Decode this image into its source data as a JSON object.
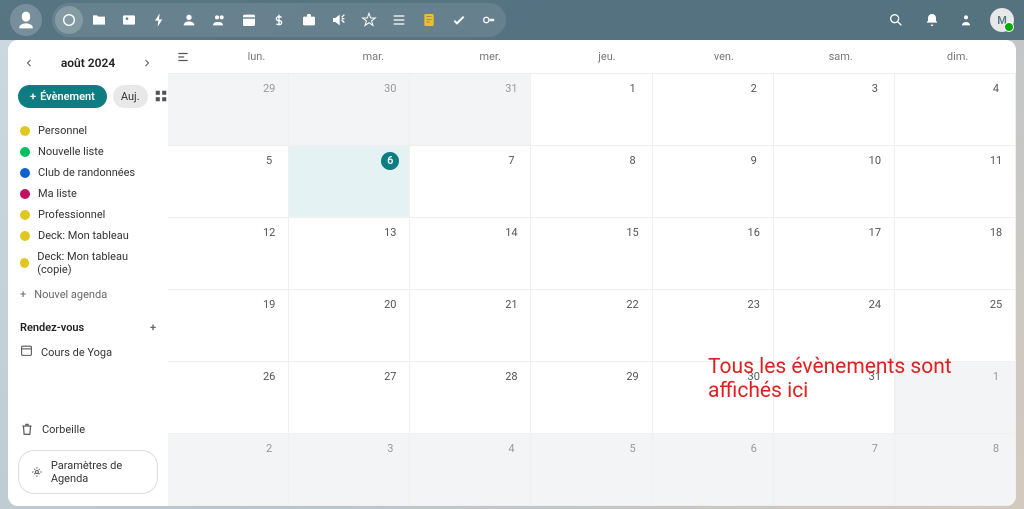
{
  "topbar": {
    "nav_icons": [
      "dashboard",
      "files",
      "photos",
      "activity",
      "contacts",
      "circles",
      "calendar",
      "money",
      "briefcase",
      "announce",
      "star",
      "list",
      "notes",
      "tasks",
      "passwords"
    ]
  },
  "sidebar": {
    "month_title": "août 2024",
    "event_btn": "Évènement",
    "today_btn": "Auj.",
    "calendars": [
      {
        "label": "Personnel",
        "color": "#e0c820"
      },
      {
        "label": "Nouvelle liste",
        "color": "#00c060"
      },
      {
        "label": "Club de randonnées",
        "color": "#1060d0"
      },
      {
        "label": "Ma liste",
        "color": "#c01060"
      },
      {
        "label": "Professionnel",
        "color": "#e0c820"
      },
      {
        "label": "Deck: Mon tableau",
        "color": "#e0c820"
      },
      {
        "label": "Deck: Mon tableau (copie)",
        "color": "#e0c820"
      }
    ],
    "new_calendar": "Nouvel agenda",
    "appointments_header": "Rendez-vous",
    "appointments": [
      {
        "label": "Cours de Yoga"
      }
    ],
    "trash": "Corbeille",
    "settings": "Paramètres de Agenda"
  },
  "calendar": {
    "weekdays": [
      "lun.",
      "mar.",
      "mer.",
      "jeu.",
      "ven.",
      "sam.",
      "dim."
    ],
    "today": 6,
    "cells": [
      {
        "n": 29,
        "other": true
      },
      {
        "n": 30,
        "other": true
      },
      {
        "n": 31,
        "other": true
      },
      {
        "n": 1,
        "other": false
      },
      {
        "n": 2,
        "other": false
      },
      {
        "n": 3,
        "other": false
      },
      {
        "n": 4,
        "other": false
      },
      {
        "n": 5,
        "other": false
      },
      {
        "n": 6,
        "other": false,
        "today": true
      },
      {
        "n": 7,
        "other": false
      },
      {
        "n": 8,
        "other": false
      },
      {
        "n": 9,
        "other": false
      },
      {
        "n": 10,
        "other": false
      },
      {
        "n": 11,
        "other": false
      },
      {
        "n": 12,
        "other": false
      },
      {
        "n": 13,
        "other": false
      },
      {
        "n": 14,
        "other": false
      },
      {
        "n": 15,
        "other": false
      },
      {
        "n": 16,
        "other": false
      },
      {
        "n": 17,
        "other": false
      },
      {
        "n": 18,
        "other": false
      },
      {
        "n": 19,
        "other": false
      },
      {
        "n": 20,
        "other": false
      },
      {
        "n": 21,
        "other": false
      },
      {
        "n": 22,
        "other": false
      },
      {
        "n": 23,
        "other": false
      },
      {
        "n": 24,
        "other": false
      },
      {
        "n": 25,
        "other": false
      },
      {
        "n": 26,
        "other": false
      },
      {
        "n": 27,
        "other": false
      },
      {
        "n": 28,
        "other": false
      },
      {
        "n": 29,
        "other": false
      },
      {
        "n": 30,
        "other": false
      },
      {
        "n": 31,
        "other": false
      },
      {
        "n": 1,
        "other": true
      },
      {
        "n": 2,
        "other": true
      },
      {
        "n": 3,
        "other": true
      },
      {
        "n": 4,
        "other": true
      },
      {
        "n": 5,
        "other": true
      },
      {
        "n": 6,
        "other": true
      },
      {
        "n": 7,
        "other": true
      },
      {
        "n": 8,
        "other": true
      }
    ]
  },
  "overlay": "Tous les évènements sont affichés ici",
  "avatar_initial": "M"
}
